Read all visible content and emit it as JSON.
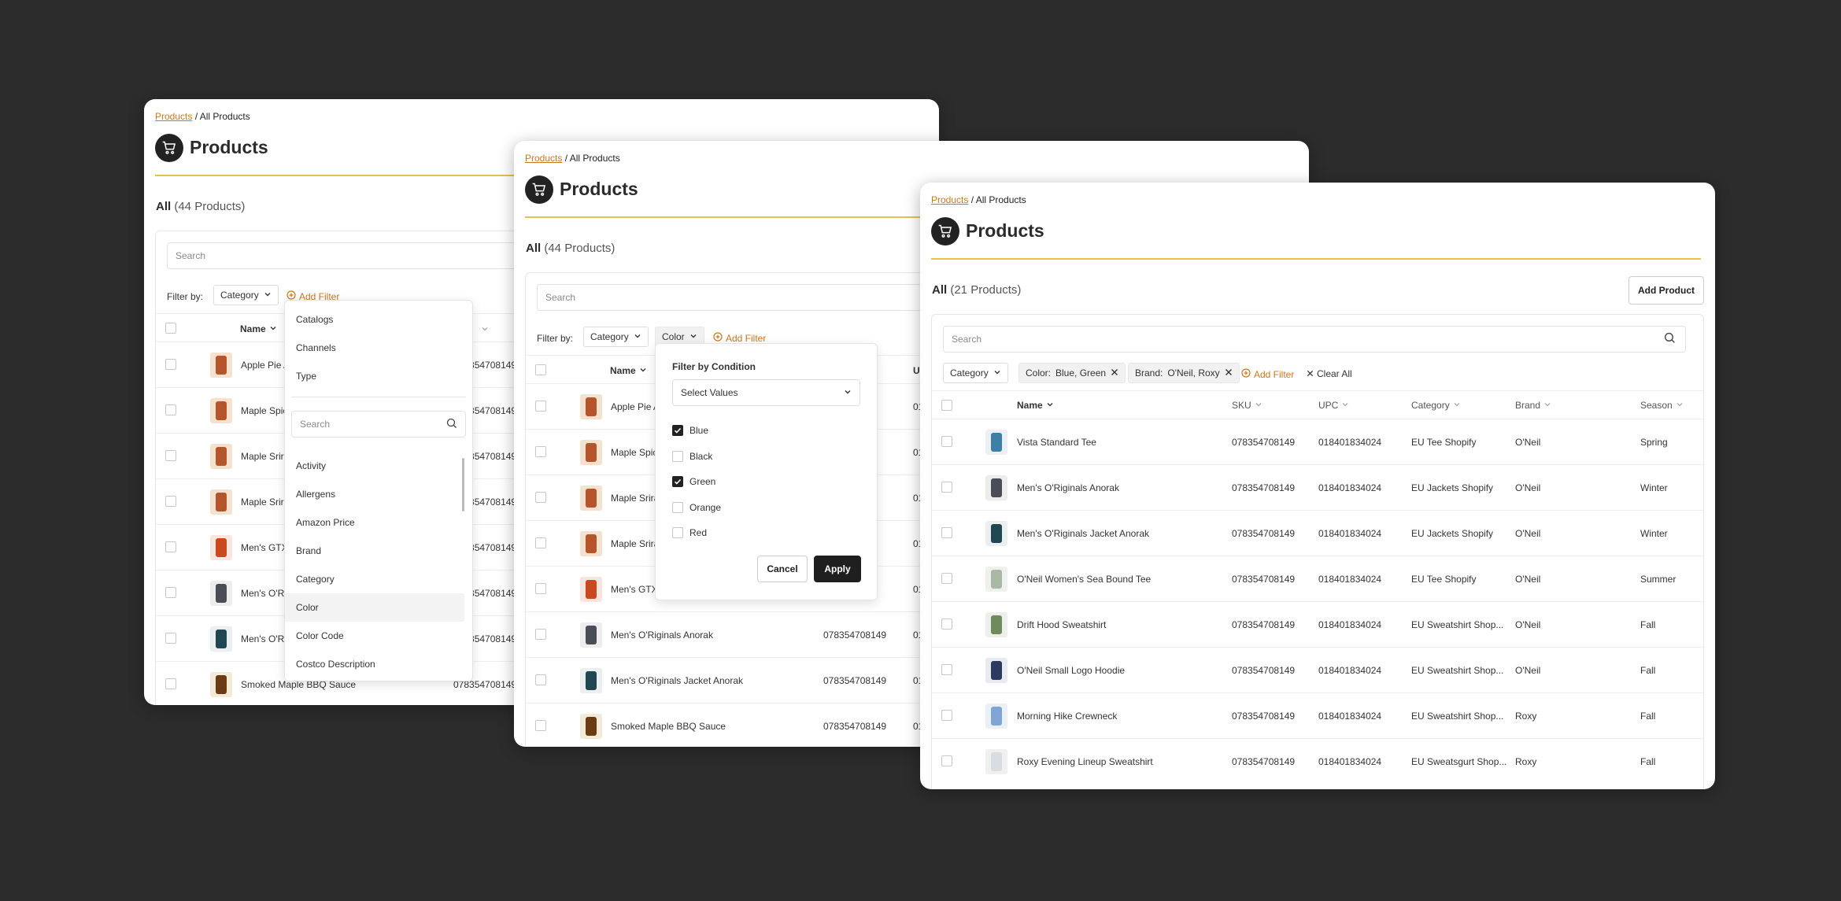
{
  "breadcrumb": {
    "link": "Products",
    "separator": " / ",
    "current": "All Products"
  },
  "page_title": "Products",
  "search_placeholder": "Search",
  "filter_label": "Filter by:",
  "add_filter": "Add Filter",
  "brand_color": "#c8781c",
  "accent_rule_color": "#e6c24c",
  "panel1": {
    "count_prefix": "All",
    "count_text": "(44 Products)",
    "chip_category": "Category",
    "col_name": "Name",
    "rows": [
      {
        "name": "Apple Pie A",
        "sku": "078354708149",
        "thumb": "jar"
      },
      {
        "name": "Maple Spic",
        "sku": "078354708149",
        "thumb": "jar"
      },
      {
        "name": "Maple Srira",
        "sku": "078354708149",
        "thumb": "jar"
      },
      {
        "name": "Maple Srira",
        "sku": "078354708149",
        "thumb": "jar"
      },
      {
        "name": "Men's GTX",
        "sku": "078354708149",
        "thumb": "jacket-orange"
      },
      {
        "name": "Men's O'Ri",
        "sku": "078354708149",
        "thumb": "jacket-gray"
      },
      {
        "name": "Men's O'Ri",
        "sku": "078354708149",
        "thumb": "jacket-teal"
      },
      {
        "name": "Smoked Maple BBQ Sauce",
        "sku": "078354708149",
        "thumb": "bottle"
      }
    ],
    "dropdown": {
      "top_items": [
        "Catalogs",
        "Channels",
        "Type"
      ],
      "search_placeholder": "Search",
      "items": [
        "Activity",
        "Allergens",
        "Amazon Price",
        "Brand",
        "Category",
        "Color",
        "Color Code",
        "Costco Description"
      ],
      "highlighted": "Color"
    }
  },
  "panel2": {
    "count_prefix": "All",
    "count_text": "(44 Products)",
    "chip_category": "Category",
    "chip_color": "Color",
    "col_name": "Name",
    "col_partial": "U",
    "rows": [
      {
        "name": "Apple Pie A",
        "sku": "",
        "u": "01",
        "thumb": "jar"
      },
      {
        "name": "Maple Spic",
        "sku": "",
        "u": "01",
        "thumb": "jar"
      },
      {
        "name": "Maple Srira",
        "sku": "",
        "u": "01",
        "thumb": "jar"
      },
      {
        "name": "Maple Srira",
        "sku": "",
        "u": "01",
        "thumb": "jar"
      },
      {
        "name": "Men's GTX",
        "sku": "",
        "u": "01",
        "thumb": "jacket-orange"
      },
      {
        "name": "Men's O'Riginals Anorak",
        "sku": "078354708149",
        "u": "01",
        "thumb": "jacket-gray"
      },
      {
        "name": "Men's O'Riginals Jacket Anorak",
        "sku": "078354708149",
        "u": "01",
        "thumb": "jacket-teal"
      },
      {
        "name": "Smoked Maple BBQ Sauce",
        "sku": "078354708149",
        "u": "01",
        "thumb": "bottle"
      }
    ],
    "popover": {
      "title": "Filter by Condition",
      "select_value": "Select Values",
      "options": [
        {
          "label": "Blue",
          "checked": true
        },
        {
          "label": "Black",
          "checked": false
        },
        {
          "label": "Green",
          "checked": true
        },
        {
          "label": "Orange",
          "checked": false
        },
        {
          "label": "Red",
          "checked": false
        }
      ],
      "cancel": "Cancel",
      "apply": "Apply"
    }
  },
  "panel3": {
    "count_prefix": "All",
    "count_text": "(21 Products)",
    "add_product": "Add Product",
    "chip_category": "Category",
    "chip_color_key": "Color:",
    "chip_color_val": "Blue, Green",
    "chip_brand_key": "Brand:",
    "chip_brand_val": "O'Neil, Roxy",
    "clear_all": "Clear All",
    "columns": {
      "name": "Name",
      "sku": "SKU",
      "upc": "UPC",
      "category": "Category",
      "brand": "Brand",
      "season": "Season"
    },
    "rows": [
      {
        "name": "Vista Standard Tee",
        "sku": "078354708149",
        "upc": "018401834024",
        "category": "EU Tee Shopify",
        "brand": "O'Neil",
        "season": "Spring",
        "thumb": "tee-blue"
      },
      {
        "name": "Men's O'Riginals Anorak",
        "sku": "078354708149",
        "upc": "018401834024",
        "category": "EU Jackets Shopify",
        "brand": "O'Neil",
        "season": "Winter",
        "thumb": "jacket-gray"
      },
      {
        "name": "Men's O'Riginals Jacket Anorak",
        "sku": "078354708149",
        "upc": "018401834024",
        "category": "EU Jackets Shopify",
        "brand": "O'Neil",
        "season": "Winter",
        "thumb": "jacket-teal"
      },
      {
        "name": "O'Neil Women's Sea Bound Tee",
        "sku": "078354708149",
        "upc": "018401834024",
        "category": "EU Tee Shopify",
        "brand": "O'Neil",
        "season": "Summer",
        "thumb": "tee-sage"
      },
      {
        "name": "Drift Hood Sweatshirt",
        "sku": "078354708149",
        "upc": "018401834024",
        "category": "EU Sweatshirt Shop...",
        "brand": "O'Neil",
        "season": "Fall",
        "thumb": "hood-green"
      },
      {
        "name": "O'Neil Small Logo Hoodie",
        "sku": "078354708149",
        "upc": "018401834024",
        "category": "EU Sweatshirt Shop...",
        "brand": "O'Neil",
        "season": "Fall",
        "thumb": "hood-navy"
      },
      {
        "name": "Morning Hike Crewneck",
        "sku": "078354708149",
        "upc": "018401834024",
        "category": "EU Sweatshirt Shop...",
        "brand": "Roxy",
        "season": "Fall",
        "thumb": "crew-blue"
      },
      {
        "name": "Roxy Evening Lineup Sweatshirt",
        "sku": "078354708149",
        "upc": "018401834024",
        "category": "EU Sweatsgurt Shop...",
        "brand": "Roxy",
        "season": "Fall",
        "thumb": "crew-white"
      }
    ]
  }
}
